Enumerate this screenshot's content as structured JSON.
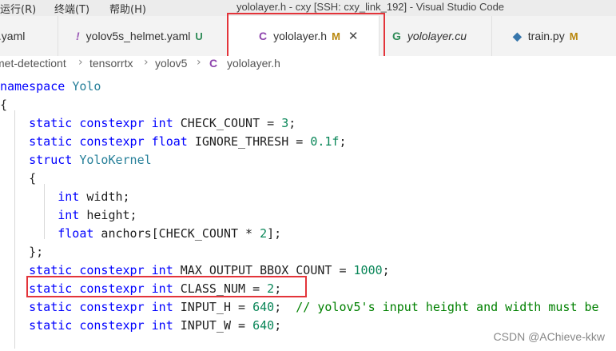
{
  "menu": {
    "run": "运行(R)",
    "terminal": "终端(T)",
    "help": "帮助(H)"
  },
  "window_title": "yololayer.h - cxy [SSH: cxy_link_192] - Visual Studio Code",
  "tabs": [
    {
      "label": "t.yaml",
      "icon": "yaml-icon",
      "badge": ""
    },
    {
      "label": "yolov5s_helmet.yaml",
      "icon": "exclamation-icon",
      "badge": "U"
    },
    {
      "label": "yololayer.h",
      "icon": "c-icon",
      "badge": "M",
      "active": true
    },
    {
      "label": "yololayer.cu",
      "icon": "cuda-icon",
      "badge": ""
    },
    {
      "label": "train.py",
      "icon": "python-icon",
      "badge": "M"
    }
  ],
  "breadcrumb": [
    "met-detectiont",
    "tensorrtx",
    "yolov5",
    "yololayer.h"
  ],
  "code_lines": [
    "namespace Yolo",
    "{",
    "    static constexpr int CHECK_COUNT = 3;",
    "    static constexpr float IGNORE_THRESH = 0.1f;",
    "    struct YoloKernel",
    "    {",
    "        int width;",
    "        int height;",
    "        float anchors[CHECK_COUNT * 2];",
    "    };",
    "    static constexpr int MAX_OUTPUT_BBOX_COUNT = 1000;",
    "    static constexpr int CLASS_NUM = 2;",
    "    static constexpr int INPUT_H = 640;  // yolov5's input height and width must be",
    "    static constexpr int INPUT_W = 640;"
  ],
  "watermark": "CSDN @AChieve-kkw",
  "colors": {
    "keyword": "#0000ff",
    "type": "#267f99",
    "number": "#098658",
    "comment": "#008000",
    "highlight_box": "#e3343a"
  }
}
